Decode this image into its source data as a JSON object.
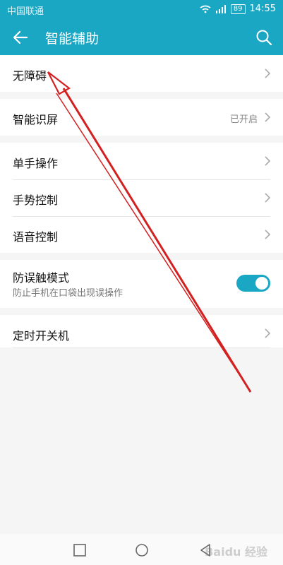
{
  "status_bar": {
    "carrier": "中国联通",
    "battery": "89",
    "time": "14:55"
  },
  "header": {
    "title": "智能辅助"
  },
  "sections": [
    [
      {
        "label": "无障碍"
      }
    ],
    [
      {
        "label": "智能识屏",
        "value": "已开启"
      }
    ],
    [
      {
        "label": "单手操作"
      },
      {
        "label": "手势控制"
      },
      {
        "label": "语音控制"
      }
    ],
    [
      {
        "label": "防误触模式",
        "sub": "防止手机在口袋出现误操作",
        "toggle_on": true
      }
    ],
    [
      {
        "label": "定时开关机"
      }
    ]
  ],
  "colors": {
    "accent": "#1aa7c4",
    "annotation": "#d32020"
  },
  "icons": [
    "back-arrow-icon",
    "search-icon",
    "chevron-right-icon",
    "square-icon",
    "circle-icon",
    "triangle-back-icon"
  ],
  "watermark": "Baidu 经验"
}
